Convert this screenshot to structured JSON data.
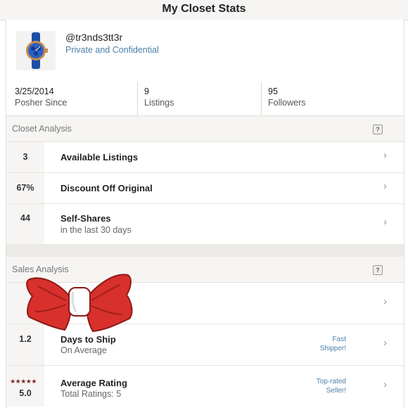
{
  "header": {
    "title": "My Closet Stats"
  },
  "profile": {
    "username": "@tr3nds3tt3r",
    "privacy": "Private and Confidential",
    "avatar_icon": "watch-photo"
  },
  "stats": [
    {
      "value": "3/25/2014",
      "label": "Posher Since"
    },
    {
      "value": "9",
      "label": "Listings"
    },
    {
      "value": "95",
      "label": "Followers"
    }
  ],
  "closet_analysis": {
    "title": "Closet Analysis",
    "help": "?",
    "rows": [
      {
        "value": "3",
        "title": "Available Listings"
      },
      {
        "value": "67%",
        "title": "Discount Off Original"
      },
      {
        "value": "44",
        "title": "Self-Shares",
        "subtitle": "in the last 30 days"
      }
    ]
  },
  "sales_analysis": {
    "title": "Sales Analysis",
    "help": "?",
    "rows": [
      {
        "value": "",
        "title": ""
      },
      {
        "value": "1.2",
        "title": "Days to Ship",
        "subtitle": "On Average",
        "badge": [
          "Fast",
          "Shipper!"
        ]
      },
      {
        "value": "5.0",
        "stars": "★★★★★",
        "title": "Average Rating",
        "subtitle": "Total Ratings: 5",
        "badge": [
          "Top-rated",
          "Seller!"
        ]
      }
    ]
  },
  "chevron": "›",
  "colors": {
    "link_blue": "#4a7fa8",
    "bow_red": "#d8302c",
    "star": "#7a2a2a"
  }
}
